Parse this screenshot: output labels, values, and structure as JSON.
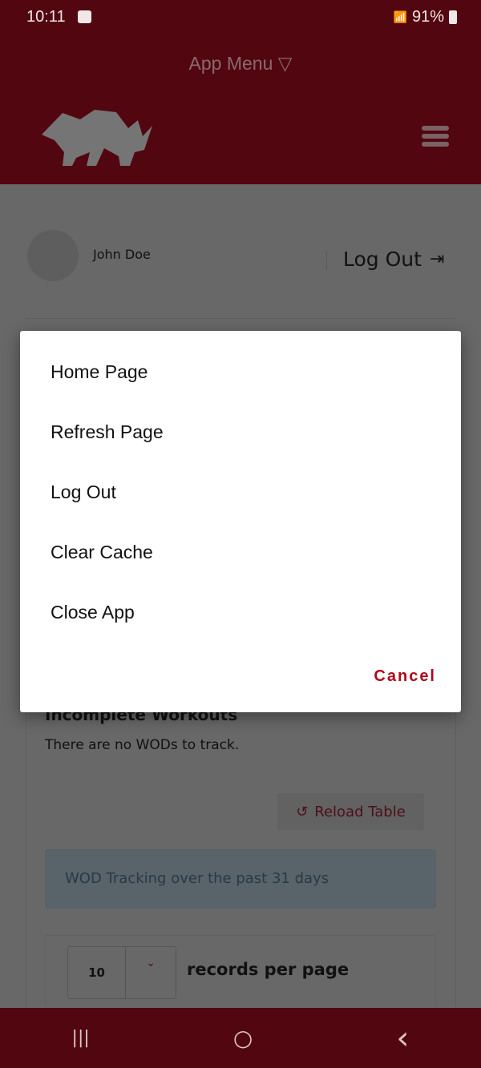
{
  "status_bar": {
    "time": "10:11",
    "battery": "91%"
  },
  "header": {
    "app_menu": "App Menu ▽",
    "brand_color": "#52060f"
  },
  "profile": {
    "name": "John Doe",
    "logout": "Log Out"
  },
  "content": {
    "incomplete_title": "Incomplete Workouts",
    "no_wods": "There are no WODs to track.",
    "reload": "Reload Table",
    "alert": "WOD Tracking over the past 31 days",
    "records_value": "10",
    "records_label": "records per page"
  },
  "dialog": {
    "items": [
      "Home Page",
      "Refresh Page",
      "Log Out",
      "Clear Cache",
      "Close App"
    ],
    "cancel": "Cancel",
    "accent": "#b0081a"
  },
  "nav": {
    "recent": "|||",
    "home": "○",
    "back": "‹"
  }
}
